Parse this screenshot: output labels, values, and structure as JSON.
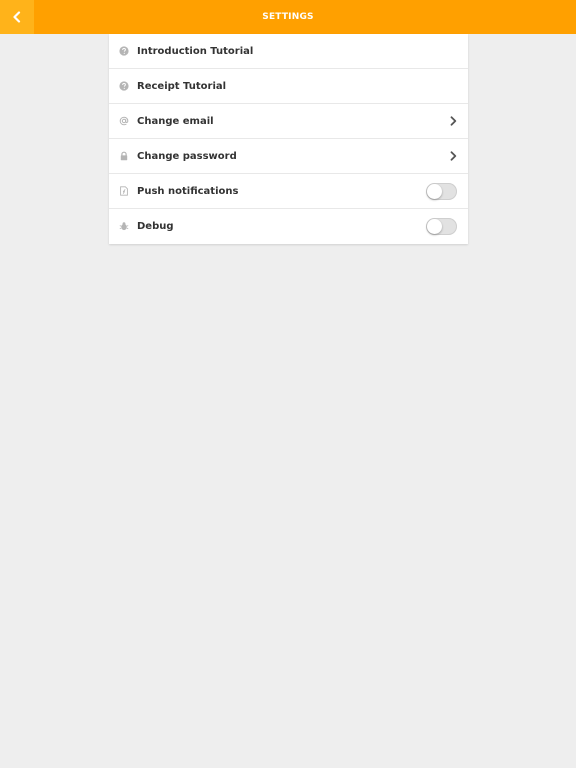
{
  "header": {
    "title": "SETTINGS",
    "back_icon": "chevron-left-icon",
    "background_color": "#ffa000",
    "back_button_color": "#ffb31a"
  },
  "settings": {
    "items": [
      {
        "label": "Introduction Tutorial",
        "icon": "help-circle-icon",
        "control": "none"
      },
      {
        "label": "Receipt Tutorial",
        "icon": "help-circle-icon",
        "control": "none"
      },
      {
        "label": "Change email",
        "icon": "at-sign-icon",
        "control": "chevron"
      },
      {
        "label": "Change password",
        "icon": "lock-icon",
        "control": "chevron"
      },
      {
        "label": "Push notifications",
        "icon": "notification-icon",
        "control": "toggle",
        "enabled": false
      },
      {
        "label": "Debug",
        "icon": "bug-icon",
        "control": "toggle",
        "enabled": false
      }
    ]
  }
}
